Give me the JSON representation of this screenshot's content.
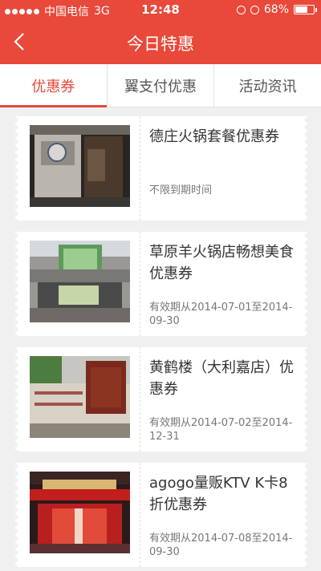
{
  "status_bar": {
    "carrier": "中国电信",
    "network": "3G",
    "time": "12:48",
    "battery": "68%",
    "battery_level": 0.68
  },
  "nav": {
    "title": "今日特惠"
  },
  "tabs": [
    {
      "label": "优惠券",
      "active": true
    },
    {
      "label": "翼支付优惠",
      "active": false
    },
    {
      "label": "活动资讯",
      "active": false
    }
  ],
  "coupons": [
    {
      "name": "德庄火锅套餐优惠券",
      "validity": "不限到期时间"
    },
    {
      "name": "草原羊火锅店畅想美食优惠券",
      "validity": "有效期从2014-07-01至2014-09-30"
    },
    {
      "name": "黄鹤楼（大利嘉店）优惠券",
      "validity": "有效期从2014-07-02至2014-12-31"
    },
    {
      "name": "agogo量贩KTV K卡8折优惠券",
      "validity": "有效期从2014-07-08至2014-09-30"
    }
  ]
}
